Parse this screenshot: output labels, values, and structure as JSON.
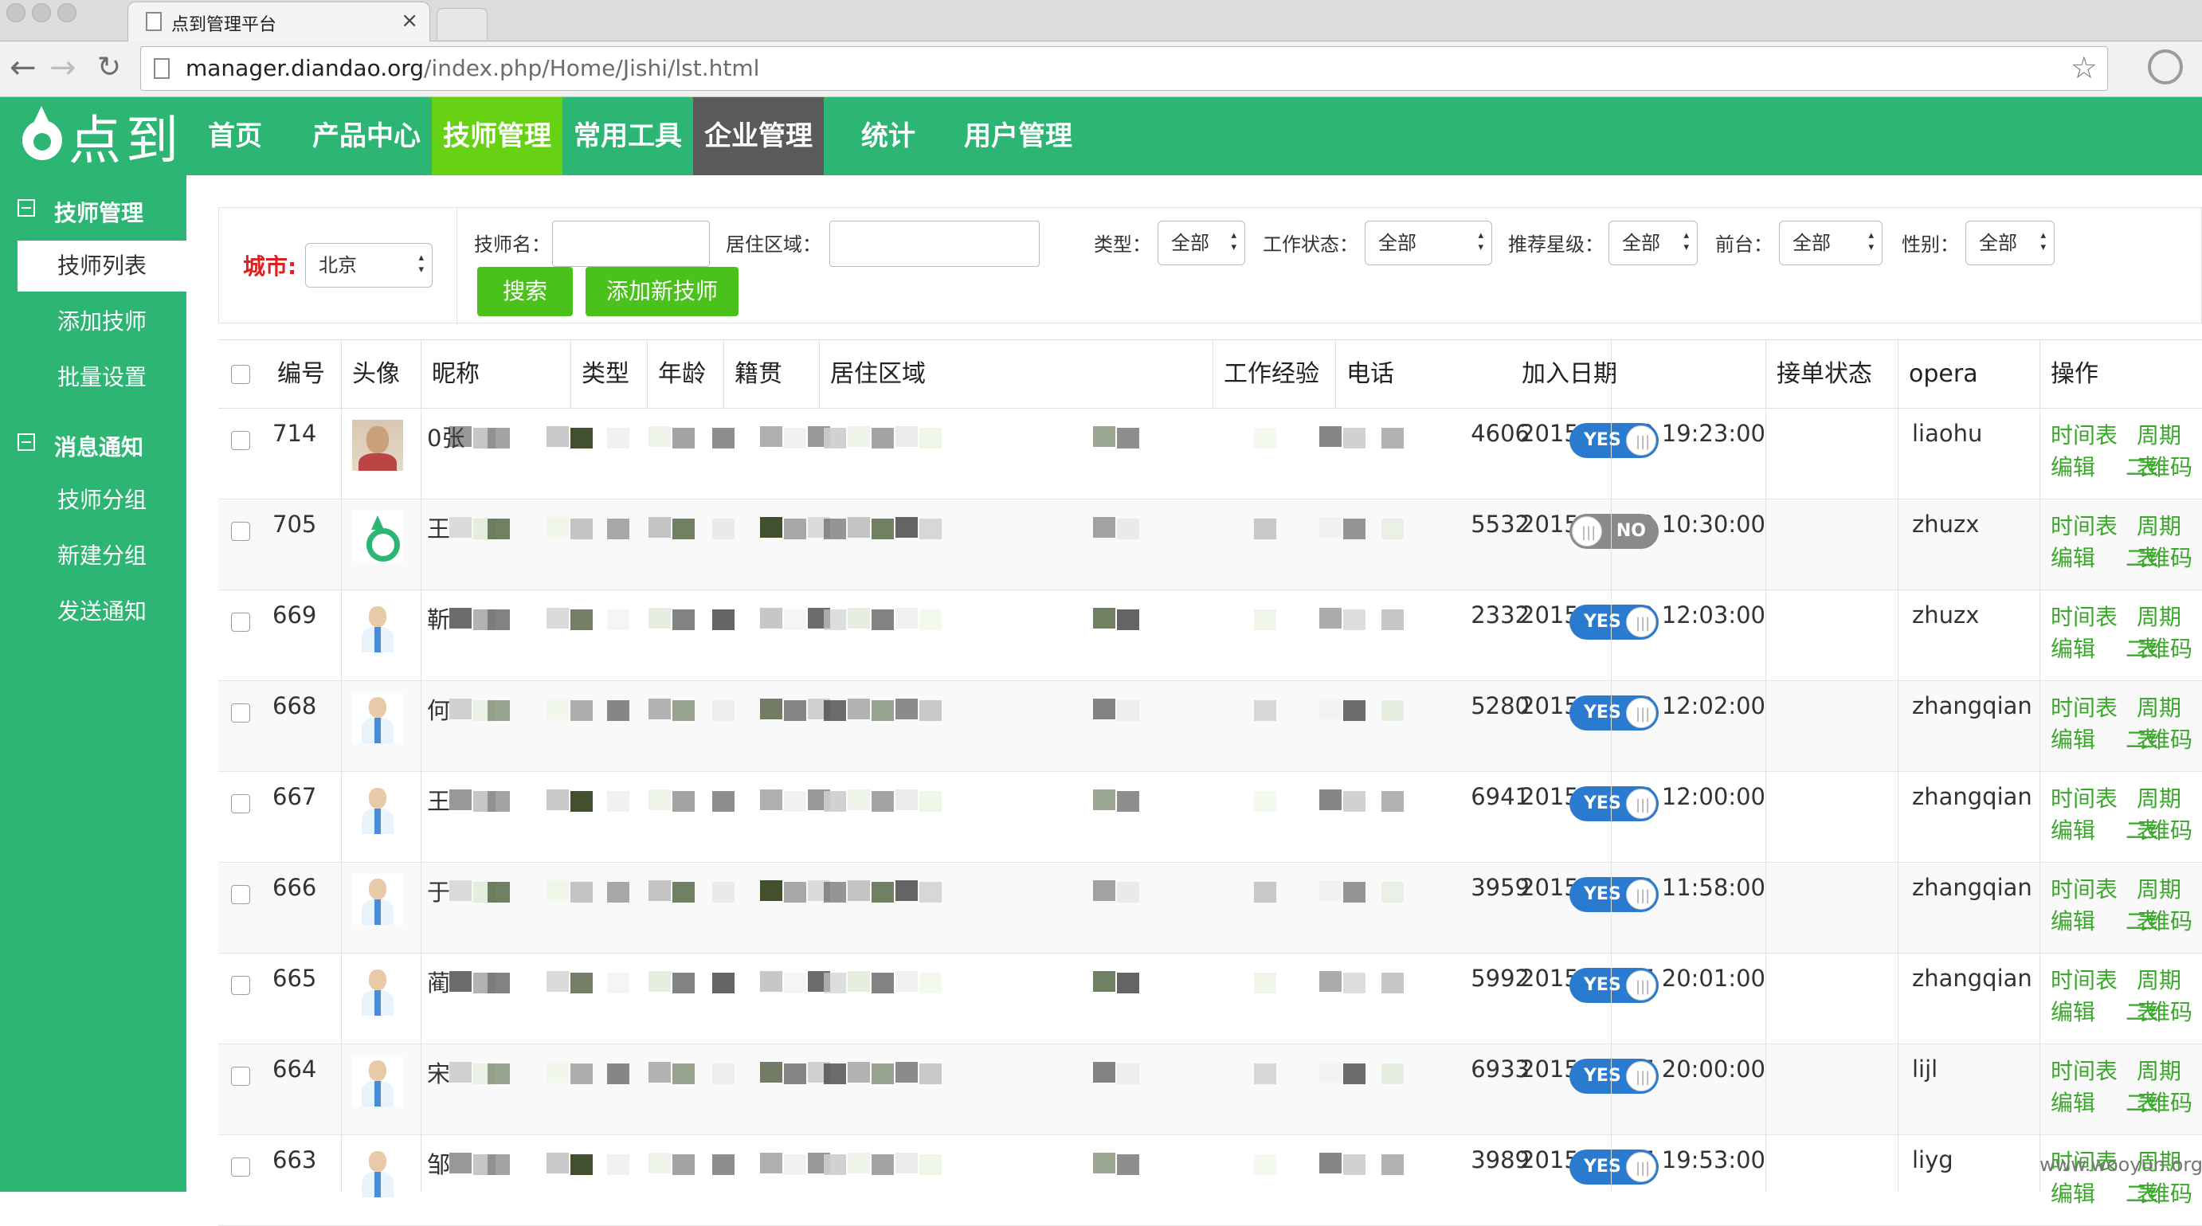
{
  "browser": {
    "tab_title": "点到管理平台",
    "tab_close": "×",
    "url_host": "manager.diandao.org",
    "url_path": "/index.php/Home/Jishi/lst.html",
    "back": "←",
    "forward": "→",
    "reload": "↻",
    "star": "☆"
  },
  "header": {
    "logo_text": "点到",
    "nav": [
      "首页",
      "产品中心",
      "技师管理",
      "常用工具",
      "企业管理",
      "统计",
      "用户管理"
    ]
  },
  "sidebar": {
    "group1": "技师管理",
    "group1_items": [
      "技师列表",
      "添加技师",
      "批量设置"
    ],
    "group2": "消息通知",
    "group2_items": [
      "技师分组",
      "新建分组",
      "发送通知"
    ]
  },
  "filter": {
    "city_label": "城市:",
    "city_value": "北京",
    "name_label": "技师名：",
    "area_label": "居住区域：",
    "type_label": "类型：",
    "type_value": "全部",
    "work_label": "工作状态：",
    "work_value": "全部",
    "star_label": "推荐星级：",
    "star_value": "全部",
    "front_label": "前台：",
    "front_value": "全部",
    "gender_label": "性别：",
    "gender_value": "全部",
    "search_btn": "搜索",
    "add_btn": "添加新技师"
  },
  "table": {
    "headers": [
      "编号",
      "头像",
      "昵称",
      "类型",
      "年龄",
      "籍贯",
      "居住区域",
      "工作经验",
      "电话",
      "加入日期",
      "接单状态",
      "opera",
      "操作"
    ],
    "rows": [
      {
        "id": "714",
        "name": "0张",
        "phone": "4606",
        "date": "2015-07-23 19:23:00",
        "status": "YES",
        "opera": "liaohu"
      },
      {
        "id": "705",
        "name": "王",
        "phone": "5532",
        "date": "2015-07-23 10:30:00",
        "status": "NO",
        "opera": "zhuzx"
      },
      {
        "id": "669",
        "name": "靳",
        "phone": "2332",
        "date": "2015-07-20 12:03:00",
        "status": "YES",
        "opera": "zhuzx"
      },
      {
        "id": "668",
        "name": "何",
        "phone": "5280",
        "date": "2015-07-20 12:02:00",
        "status": "YES",
        "opera": "zhangqian"
      },
      {
        "id": "667",
        "name": "王",
        "phone": "6941",
        "date": "2015-07-20 12:00:00",
        "status": "YES",
        "opera": "zhangqian"
      },
      {
        "id": "666",
        "name": "于",
        "phone": "3959",
        "date": "2015-07-20 11:58:00",
        "status": "YES",
        "opera": "zhangqian"
      },
      {
        "id": "665",
        "name": "蔺",
        "phone": "5992",
        "date": "2015-07-17 20:01:00",
        "status": "YES",
        "opera": "zhangqian"
      },
      {
        "id": "664",
        "name": "宋",
        "phone": "6933",
        "date": "2015-07-17 20:00:00",
        "status": "YES",
        "opera": "lijl"
      },
      {
        "id": "663",
        "name": "邹",
        "phone": "3989",
        "date": "2015-07-17 19:53:00",
        "status": "YES",
        "opera": "liyg"
      }
    ],
    "op_labels": [
      "时间表",
      "周期表",
      "编辑",
      "二维码"
    ]
  },
  "watermark": "www.wooyun.org",
  "colors": {
    "brand_green": "#2db574",
    "active_nav": "#67d214",
    "toggle_blue": "#2a7bd0",
    "link_green": "#3aa82a"
  }
}
